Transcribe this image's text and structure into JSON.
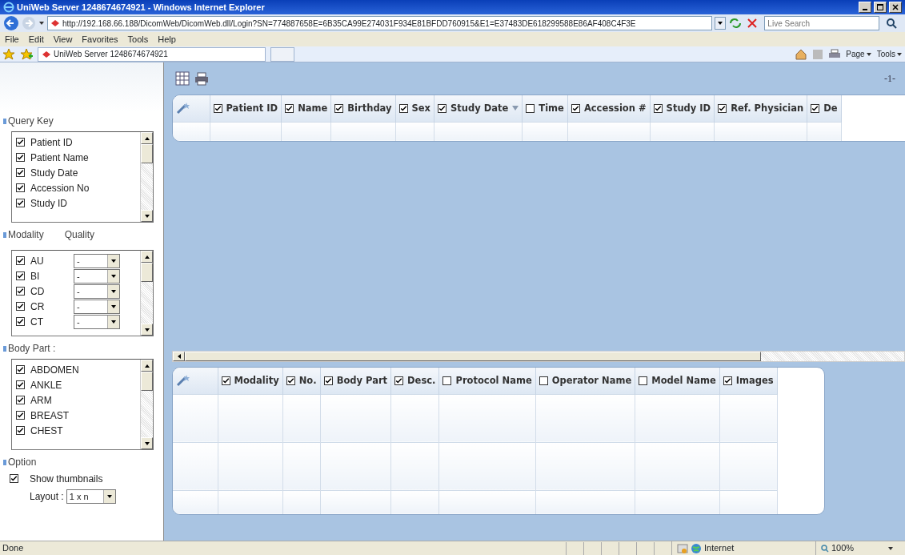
{
  "window": {
    "title": "UniWeb Server 1248674674921 - Windows Internet Explorer"
  },
  "address_bar": {
    "url": "http://192.168.66.188/DicomWeb/DicomWeb.dll/Login?SN=774887658E=6B35CA99E274031F934E81BFDD760915&E1=E37483DE618299588E86AF408C4F3E"
  },
  "search": {
    "placeholder": "Live Search"
  },
  "menu": [
    "File",
    "Edit",
    "View",
    "Favorites",
    "Tools",
    "Help"
  ],
  "tab": {
    "label": "UniWeb Server 1248674674921"
  },
  "command_bar": [
    "Page",
    "Tools"
  ],
  "sidebar": {
    "query_key": {
      "title": "Query Key",
      "items": [
        {
          "label": "Patient ID",
          "checked": true
        },
        {
          "label": "Patient Name",
          "checked": true
        },
        {
          "label": "Study Date",
          "checked": true
        },
        {
          "label": "Accession No",
          "checked": true
        },
        {
          "label": "Study ID",
          "checked": true
        }
      ]
    },
    "modality": {
      "title": "Modality",
      "quality_title": "Quality",
      "items": [
        {
          "label": "AU",
          "checked": true,
          "quality": "-"
        },
        {
          "label": "BI",
          "checked": true,
          "quality": "-"
        },
        {
          "label": "CD",
          "checked": true,
          "quality": "-"
        },
        {
          "label": "CR",
          "checked": true,
          "quality": "-"
        },
        {
          "label": "CT",
          "checked": true,
          "quality": "-"
        }
      ]
    },
    "body_part": {
      "title": "Body Part :",
      "items": [
        {
          "label": "ABDOMEN",
          "checked": true
        },
        {
          "label": "ANKLE",
          "checked": true
        },
        {
          "label": "ARM",
          "checked": true
        },
        {
          "label": "BREAST",
          "checked": true
        },
        {
          "label": "CHEST",
          "checked": true
        }
      ]
    },
    "option": {
      "title": "Option",
      "show_thumbnails": {
        "label": "Show thumbnails",
        "checked": true
      },
      "layout": {
        "label": "Layout :",
        "value": "1 x n"
      }
    }
  },
  "page_number": "-1-",
  "study_table": {
    "columns": [
      {
        "label": "Patient ID",
        "checked": true,
        "sorted": false
      },
      {
        "label": "Name",
        "checked": true,
        "sorted": false
      },
      {
        "label": "Birthday",
        "checked": true,
        "sorted": false
      },
      {
        "label": "Sex",
        "checked": true,
        "sorted": false
      },
      {
        "label": "Study Date",
        "checked": true,
        "sorted": true
      },
      {
        "label": "Time",
        "checked": false,
        "sorted": false
      },
      {
        "label": "Accession #",
        "checked": true,
        "sorted": false
      },
      {
        "label": "Study ID",
        "checked": true,
        "sorted": false
      },
      {
        "label": "Ref. Physician",
        "checked": true,
        "sorted": false
      },
      {
        "label": "De",
        "checked": true,
        "sorted": false
      }
    ]
  },
  "series_table": {
    "columns": [
      {
        "label": "Modality",
        "checked": true
      },
      {
        "label": "No.",
        "checked": true
      },
      {
        "label": "Body Part",
        "checked": true
      },
      {
        "label": "Desc.",
        "checked": true
      },
      {
        "label": "Protocol Name",
        "checked": false
      },
      {
        "label": "Operator Name",
        "checked": false
      },
      {
        "label": "Model Name",
        "checked": false
      },
      {
        "label": "Images",
        "checked": true
      }
    ]
  },
  "status_bar": {
    "text": "Done",
    "zone": "Internet",
    "zoom": "100%"
  }
}
